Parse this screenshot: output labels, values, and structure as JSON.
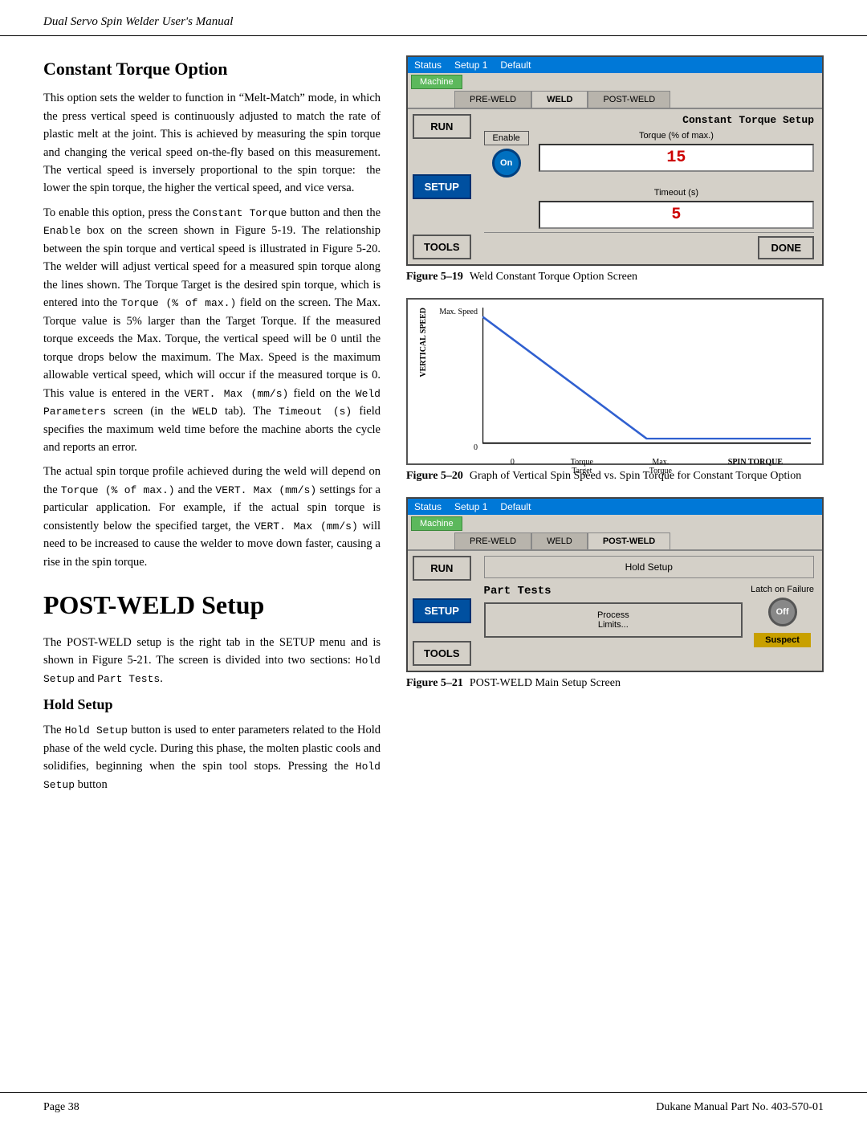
{
  "header": {
    "text": "Dual Servo Spin Welder User's Manual"
  },
  "footer": {
    "left": "Page   38",
    "right": "Dukane Manual Part No. 403-570-01"
  },
  "left_col": {
    "constant_torque_heading": "Constant Torque Option",
    "constant_torque_paragraphs": [
      "This option sets the welder to function in “Melt-Match” mode, in which the press vertical speed is continuously adjusted to match the rate of plastic melt at the joint. This is achieved by measuring the spin torque and changing the verical speed on-the-fly based on this measurement. The vertical speed is inversely proportional to the spin torque: the lower the spin torque, the higher the vertical speed, and vice versa.",
      "To enable this option, press the Constant Torque button and then the Enable box on the screen shown in Figure 5-19. The relationship between the spin torque and vertical speed is illustrated in Figure 5-20. The welder will adjust vertical speed for a measured spin torque along the lines shown. The Torque Target is the desired spin torque, which is entered into the Torque (% of max.) field on the screen. The Max. Torque value is 5% larger than the Target Torque. If the measured torque exceeds the Max. Torque, the vertical speed will be 0 until the torque drops below the maximum. The Max. Speed is the maximum allowable vertical speed, which will occur if the measured torque is 0. This value is entered in the VERT. Max (mm/s) field on the Weld Parameters screen (in the WELD tab). The Timeout (s) field specifies the maximum weld time before the machine aborts the cycle and reports an error.",
      "The actual spin torque profile achieved during the weld will depend on the Torque (% of max.) and the VERT. Max (mm/s) settings for a particular application. For example, if the actual spin torque is consistently below the specified target, the VERT. Max (mm/s) will need to be increased to cause the welder to move down faster, causing a rise in the spin torque."
    ],
    "post_weld_heading": "POST-WELD Setup",
    "post_weld_paragraphs": [
      "The POST-WELD setup is the right tab in the SETUP menu and is shown in Figure 5-21. The screen is divided into two sections: Hold Setup and Part Tests.",
      ""
    ],
    "hold_setup_heading": "Hold Setup",
    "hold_setup_paragraph": "The Hold Setup button is used to enter parameters related to the Hold phase of the weld cycle. During this phase, the molten plastic cools and solidifies, beginning when the spin tool stops. Pressing the Hold Setup button"
  },
  "figure19": {
    "caption_num": "Figure 5–19",
    "caption_text": "Weld Constant Torque Option Screen",
    "screen": {
      "topbar_status": "Status",
      "topbar_setup": "Setup 1",
      "topbar_default": "Default",
      "machine_btn": "Machine",
      "tabs": [
        "PRE-WELD",
        "WELD",
        "POST-WELD"
      ],
      "active_tab": "WELD",
      "screen_title": "Constant Torque Setup",
      "torque_label": "Torque (% of max.)",
      "torque_value": "15",
      "timeout_label": "Timeout (s)",
      "timeout_value": "5",
      "enable_label": "Enable",
      "enable_circle": "On",
      "run_btn": "RUN",
      "setup_btn": "SETUP",
      "tools_btn": "TOOLS",
      "done_btn": "DONE"
    }
  },
  "figure20": {
    "caption_num": "Figure 5–20",
    "caption_text": "Graph of Vertical Spin Speed vs. Spin Torque for Constant Torque Option",
    "chart": {
      "y_axis_title": "VERTICAL SPEED",
      "y_label_max": "Max. Speed",
      "y_label_0": "0",
      "x_label_0": "0",
      "x_label_torque_target": "Torque Target",
      "x_label_max_torque": "Max. Torque",
      "x_axis_title": "SPIN TORQUE"
    }
  },
  "figure21": {
    "caption_num": "Figure 5–21",
    "caption_text": "POST-WELD Main Setup Screen",
    "screen": {
      "topbar_status": "Status",
      "topbar_setup": "Setup 1",
      "topbar_default": "Default",
      "machine_btn": "Machine",
      "tabs": [
        "PRE-WELD",
        "WELD",
        "POST-WELD"
      ],
      "active_tab": "POST-WELD",
      "hold_setup_btn": "Hold Setup",
      "part_tests_title": "Part Tests",
      "latch_label": "Latch on Failure",
      "latch_circle": "Off",
      "process_limits_btn": "Process\nLimits...",
      "suspect_badge": "Suspect",
      "run_btn": "RUN",
      "setup_btn": "SETUP",
      "tools_btn": "TOOLS"
    }
  }
}
